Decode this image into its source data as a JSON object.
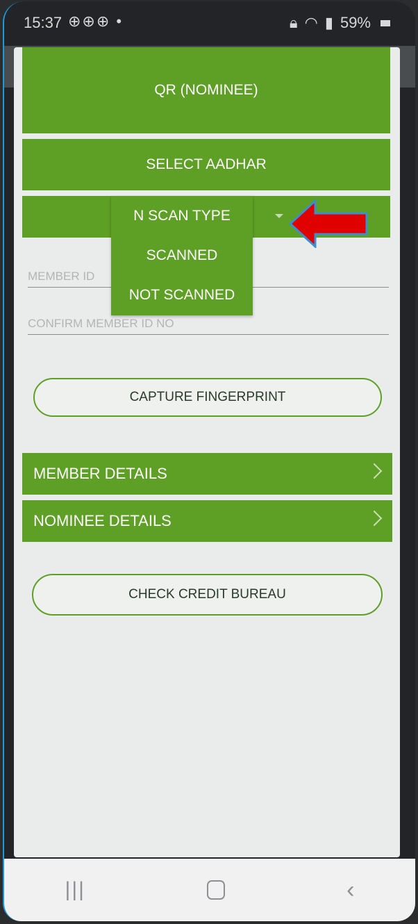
{
  "status_bar": {
    "time": "15:37",
    "icons_left": "⊕⊕⊕ •",
    "battery": "59%"
  },
  "buttons": {
    "qr_nominee": "QR (NOMINEE)",
    "select_aadhar": "SELECT AADHAR",
    "capture_fingerprint": "CAPTURE FINGERPRINT",
    "check_credit_bureau": "CHECK CREDIT BUREAU"
  },
  "dropdown": {
    "items": [
      "N SCAN TYPE",
      "SCANNED",
      "NOT SCANNED"
    ]
  },
  "inputs": {
    "member_id_placeholder": "MEMBER ID",
    "confirm_member_id_placeholder": "CONFIRM MEMBER ID NO"
  },
  "sections": {
    "member_details": "MEMBER DETAILS",
    "nominee_details": "NOMINEE DETAILS"
  },
  "colors": {
    "primary_green": "#5e9f25",
    "arrow_red": "#e00000",
    "arrow_outline": "#3a8fd0"
  }
}
